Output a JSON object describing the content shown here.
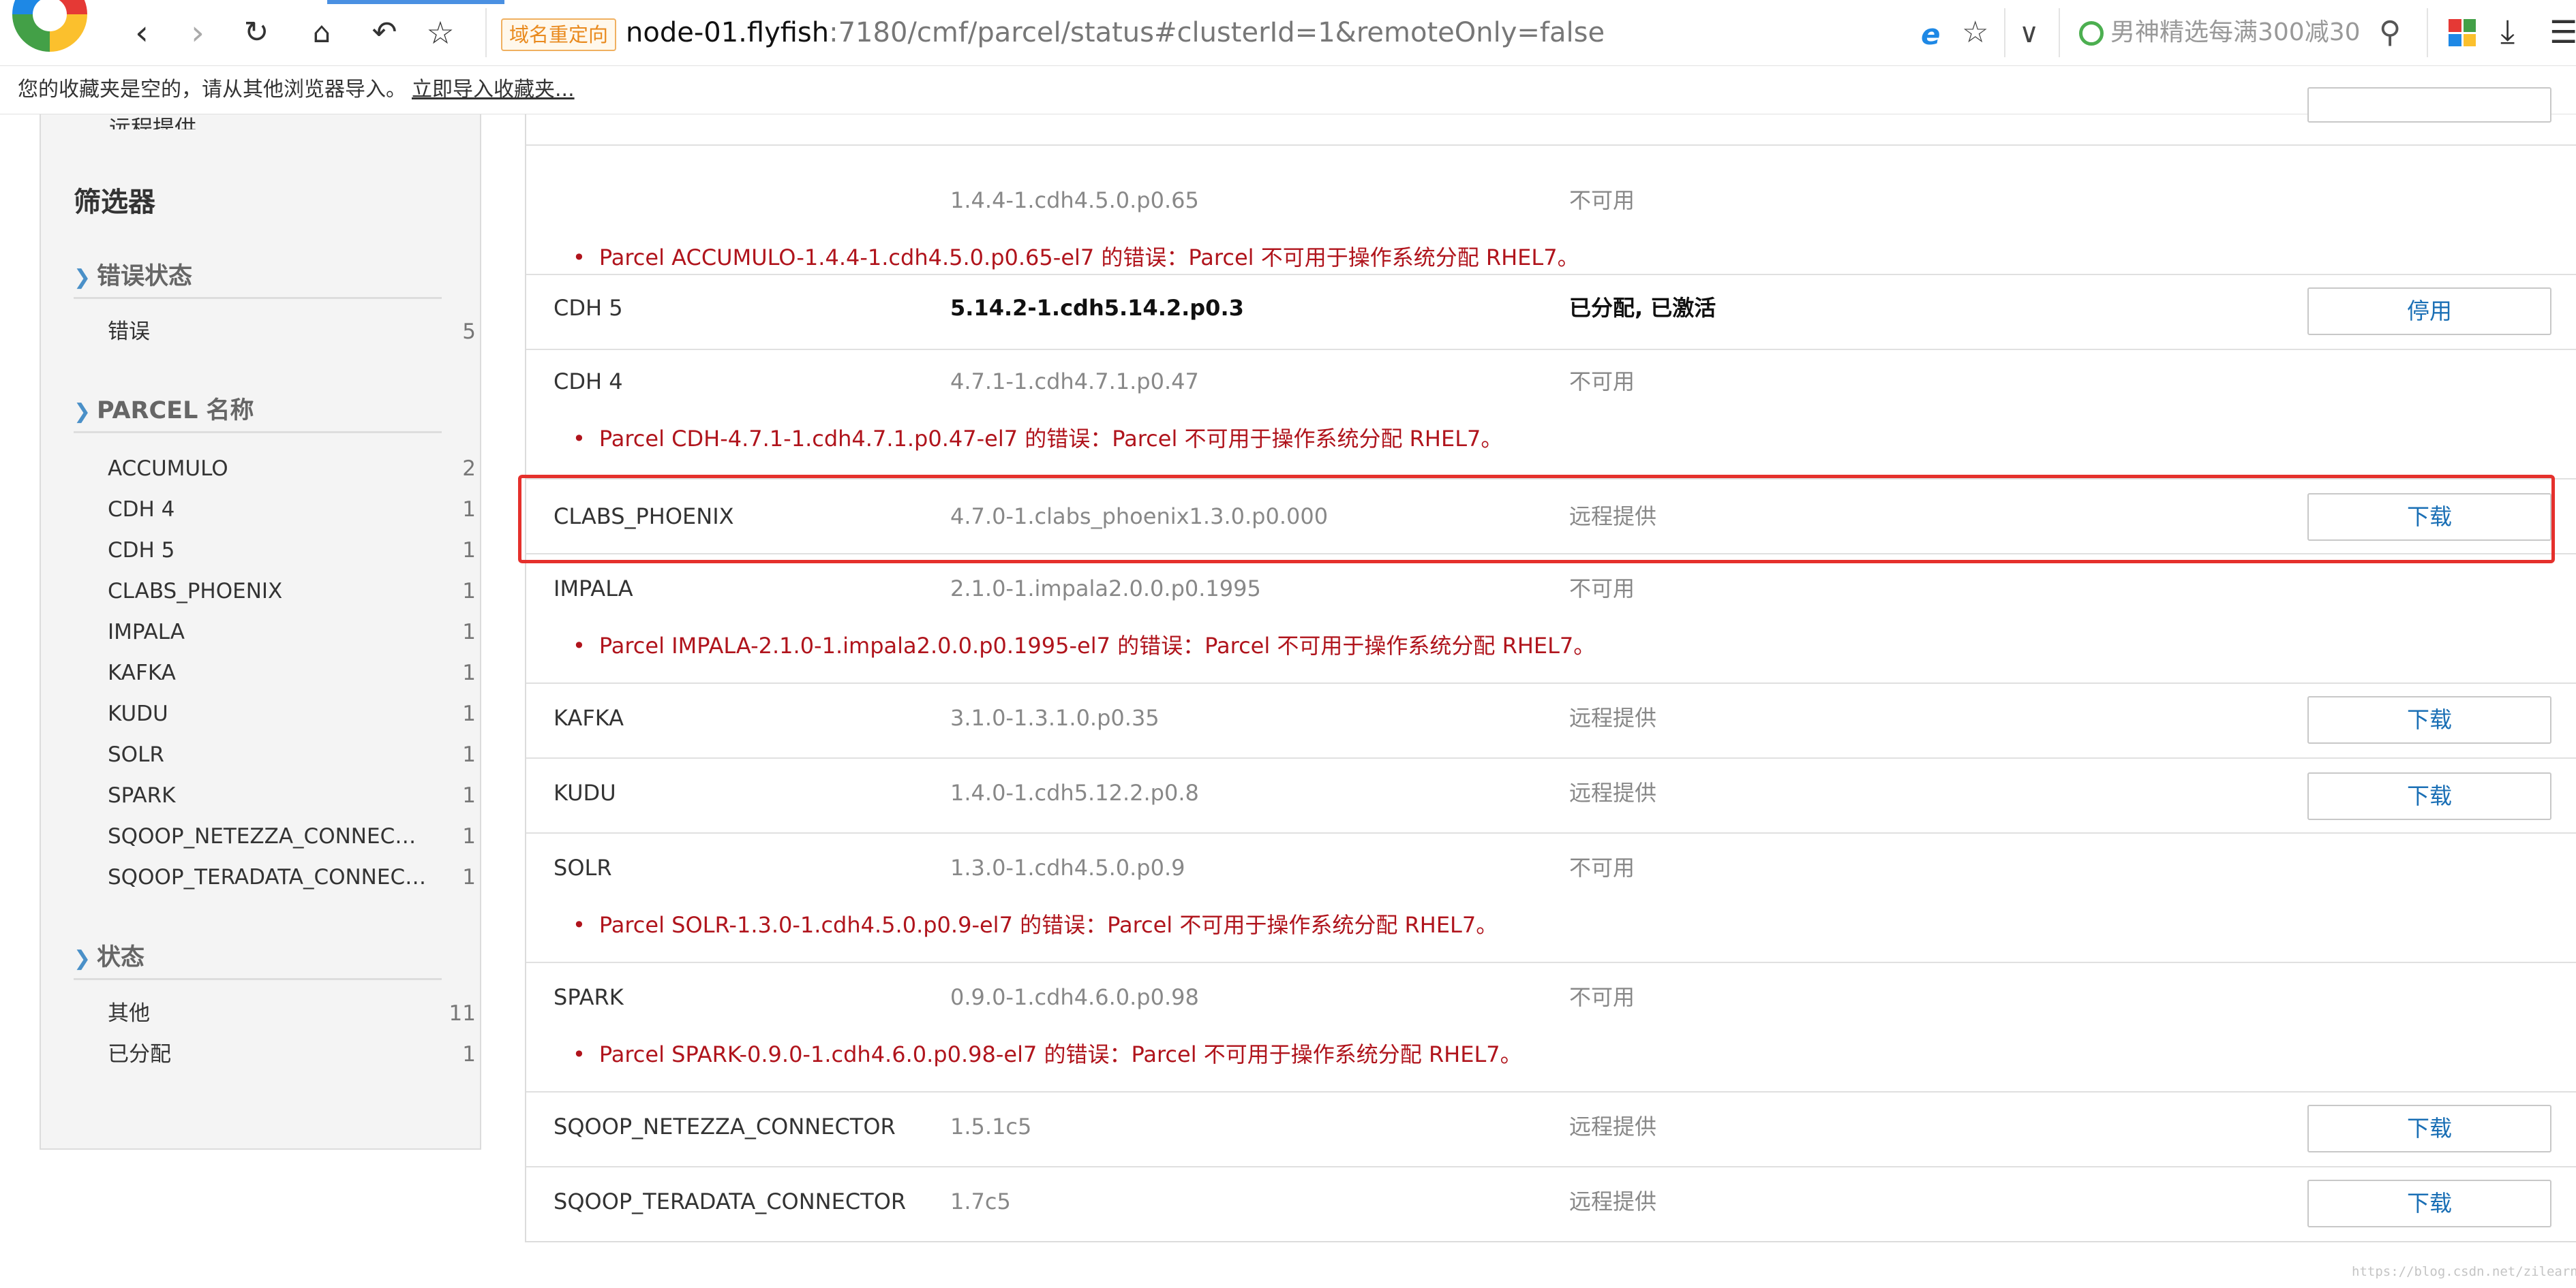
{
  "browser": {
    "redirect_badge": "域名重定向",
    "url_host": "node-01.flyfish",
    "url_rest": ":7180/cmf/parcel/status#clusterId=1&remoteOnly=false",
    "search_placeholder": "男神精选每满300减30",
    "favorites_text": "您的收藏夹是空的，请从其他浏览器导入。",
    "favorites_link": "立即导入收藏夹..."
  },
  "sidebar": {
    "top_partial": "远程提供",
    "filter_title": "筛选器",
    "groups": [
      {
        "title": "错误状态",
        "items": [
          {
            "label": "错误",
            "count": "5"
          }
        ]
      },
      {
        "title": "PARCEL 名称",
        "items": [
          {
            "label": "ACCUMULO",
            "count": "2"
          },
          {
            "label": "CDH 4",
            "count": "1"
          },
          {
            "label": "CDH 5",
            "count": "1"
          },
          {
            "label": "CLABS_PHOENIX",
            "count": "1"
          },
          {
            "label": "IMPALA",
            "count": "1"
          },
          {
            "label": "KAFKA",
            "count": "1"
          },
          {
            "label": "KUDU",
            "count": "1"
          },
          {
            "label": "SOLR",
            "count": "1"
          },
          {
            "label": "SPARK",
            "count": "1"
          },
          {
            "label": "SQOOP_NETEZZA_CONNECTOR",
            "count": "1"
          },
          {
            "label": "SQOOP_TERADATA_CONNECTOR",
            "count": "1"
          }
        ]
      },
      {
        "title": "状态",
        "items": [
          {
            "label": "其他",
            "count": "11"
          },
          {
            "label": "已分配",
            "count": "1"
          }
        ]
      }
    ]
  },
  "parcels": [
    {
      "name": "",
      "version": "1.4.4-1.cdh4.5.0.p0.65",
      "status": "不可用",
      "error": "Parcel ACCUMULO-1.4.4-1.cdh4.5.0.p0.65-el7 的错误：Parcel 不可用于操作系统分配 RHEL7。"
    },
    {
      "name": "CDH 5",
      "version": "5.14.2-1.cdh5.14.2.p0.3",
      "status": "已分配, 已激活",
      "action": "停用"
    },
    {
      "name": "CDH 4",
      "version": "4.7.1-1.cdh4.7.1.p0.47",
      "status": "不可用",
      "error": "Parcel CDH-4.7.1-1.cdh4.7.1.p0.47-el7 的错误：Parcel 不可用于操作系统分配 RHEL7。"
    },
    {
      "name": "CLABS_PHOENIX",
      "version": "4.7.0-1.clabs_phoenix1.3.0.p0.000",
      "status": "远程提供",
      "action": "下载"
    },
    {
      "name": "IMPALA",
      "version": "2.1.0-1.impala2.0.0.p0.1995",
      "status": "不可用",
      "error": "Parcel IMPALA-2.1.0-1.impala2.0.0.p0.1995-el7 的错误：Parcel 不可用于操作系统分配 RHEL7。"
    },
    {
      "name": "KAFKA",
      "version": "3.1.0-1.3.1.0.p0.35",
      "status": "远程提供",
      "action": "下载"
    },
    {
      "name": "KUDU",
      "version": "1.4.0-1.cdh5.12.2.p0.8",
      "status": "远程提供",
      "action": "下载"
    },
    {
      "name": "SOLR",
      "version": "1.3.0-1.cdh4.5.0.p0.9",
      "status": "不可用",
      "error": "Parcel SOLR-1.3.0-1.cdh4.5.0.p0.9-el7 的错误：Parcel 不可用于操作系统分配 RHEL7。"
    },
    {
      "name": "SPARK",
      "version": "0.9.0-1.cdh4.6.0.p0.98",
      "status": "不可用",
      "error": "Parcel SPARK-0.9.0-1.cdh4.6.0.p0.98-el7 的错误：Parcel 不可用于操作系统分配 RHEL7。"
    },
    {
      "name": "SQOOP_NETEZZA_CONNECTOR",
      "version": "1.5.1c5",
      "status": "远程提供",
      "action": "下载"
    },
    {
      "name": "SQOOP_TERADATA_CONNECTOR",
      "version": "1.7c5",
      "status": "远程提供",
      "action": "下载"
    }
  ],
  "watermark": "https://blog.csdn.net/zilearnfish",
  "colors": {
    "error": "#b0141c",
    "link_button": "#1a6fb5",
    "highlight": "#e5302c",
    "filter_caret": "#4a90c8"
  }
}
